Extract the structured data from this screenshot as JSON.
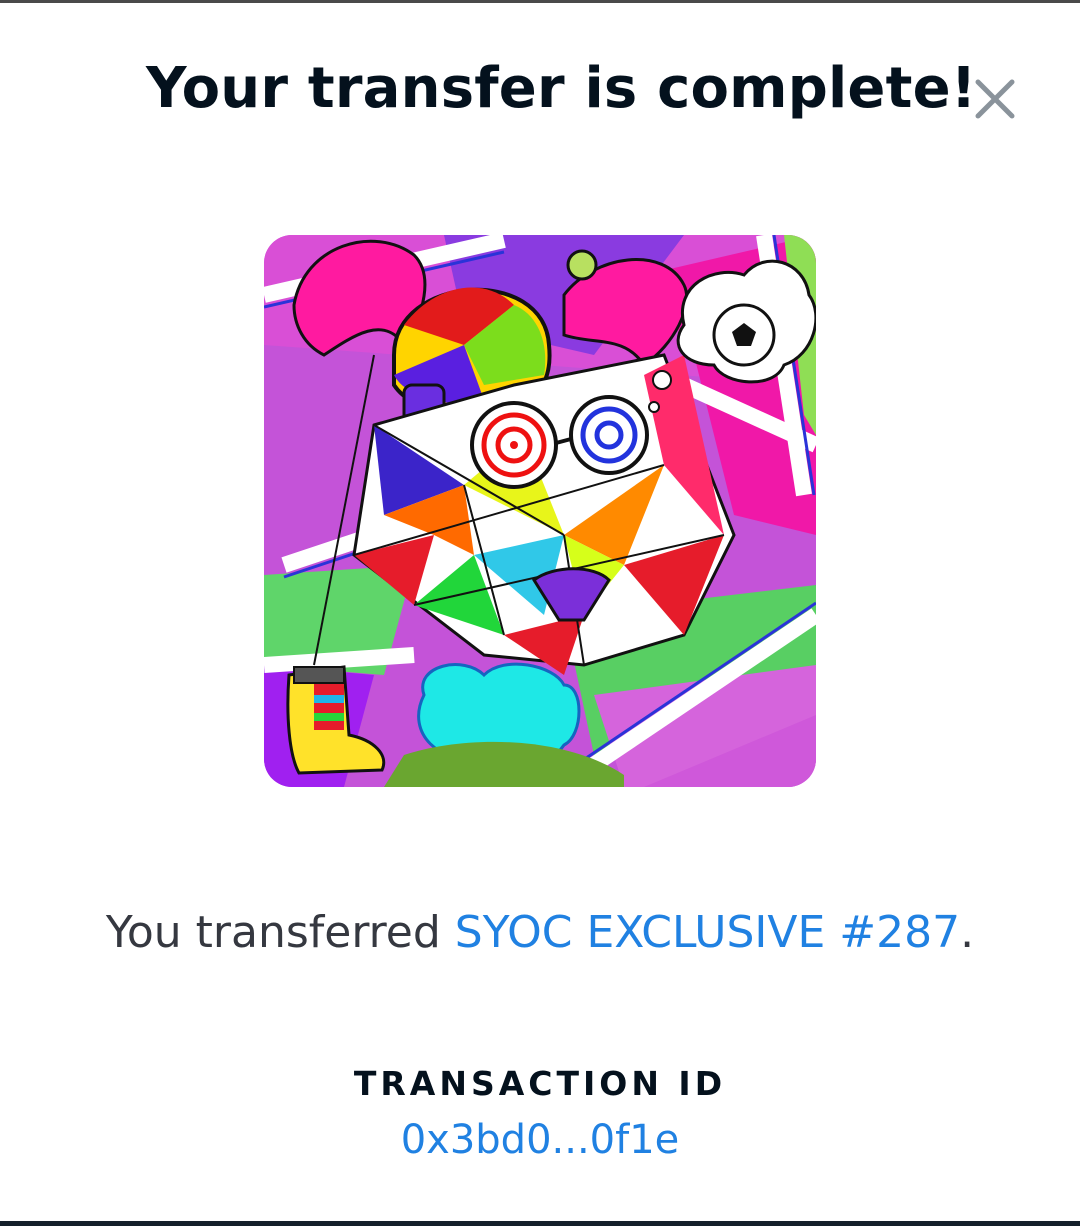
{
  "dialog": {
    "title": "Your transfer is complete!",
    "close_icon": "close-icon"
  },
  "nft": {
    "image_alt": "SYOC EXCLUSIVE #287"
  },
  "message": {
    "prefix": "You transferred ",
    "item_name": "SYOC EXCLUSIVE #287",
    "suffix": "."
  },
  "transaction": {
    "label": "TRANSACTION ID",
    "id": "0x3bd0...0f1e"
  },
  "colors": {
    "title": "#04111d",
    "link": "#2081e2",
    "body_text": "#353840",
    "close_icon": "#8a939b"
  }
}
